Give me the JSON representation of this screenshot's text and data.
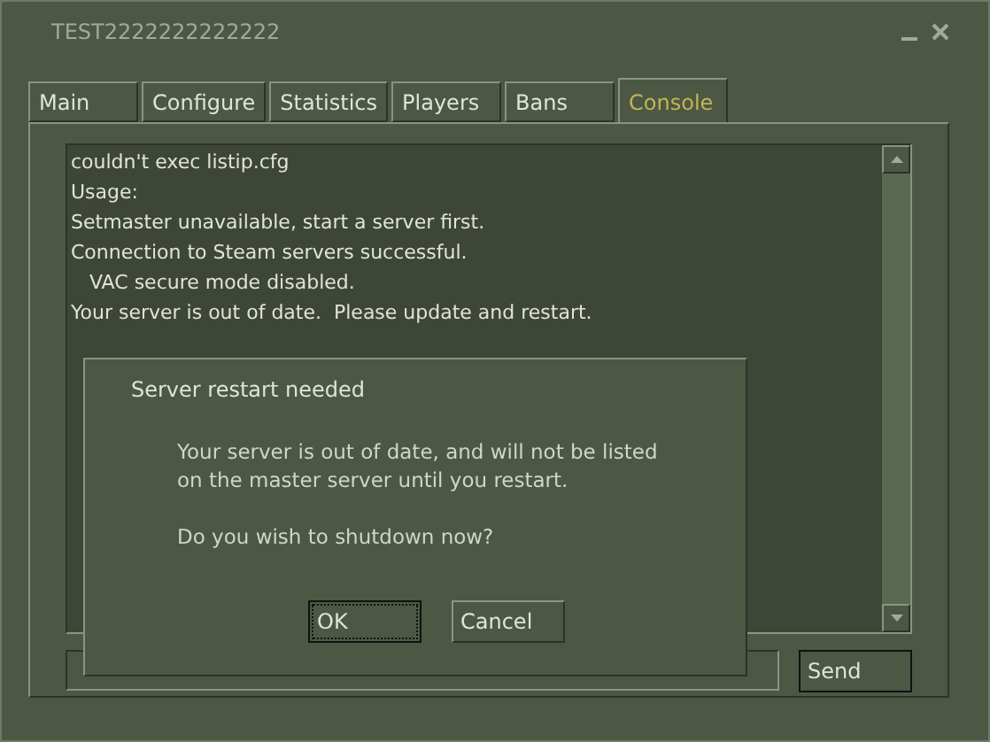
{
  "window": {
    "title": "TEST2222222222222"
  },
  "tabs": [
    {
      "label": "Main",
      "selected": false
    },
    {
      "label": "Configure",
      "selected": false
    },
    {
      "label": "Statistics",
      "selected": false
    },
    {
      "label": "Players",
      "selected": false
    },
    {
      "label": "Bans",
      "selected": false
    },
    {
      "label": "Console",
      "selected": true
    }
  ],
  "console": {
    "lines": [
      "couldn't exec listip.cfg",
      "Usage:",
      "Setmaster unavailable, start a server first.",
      "Connection to Steam servers successful.",
      "   VAC secure mode disabled.",
      "Your server is out of date.  Please update and restart."
    ],
    "send_button": "Send"
  },
  "dialog": {
    "title": "Server restart needed",
    "message": [
      "Your server is out of date, and will not be listed",
      "on the master server until you restart."
    ],
    "question": "Do you wish to shutdown now?",
    "buttons": [
      {
        "label": "OK",
        "focused": true
      },
      {
        "label": "Cancel",
        "focused": false
      }
    ]
  }
}
